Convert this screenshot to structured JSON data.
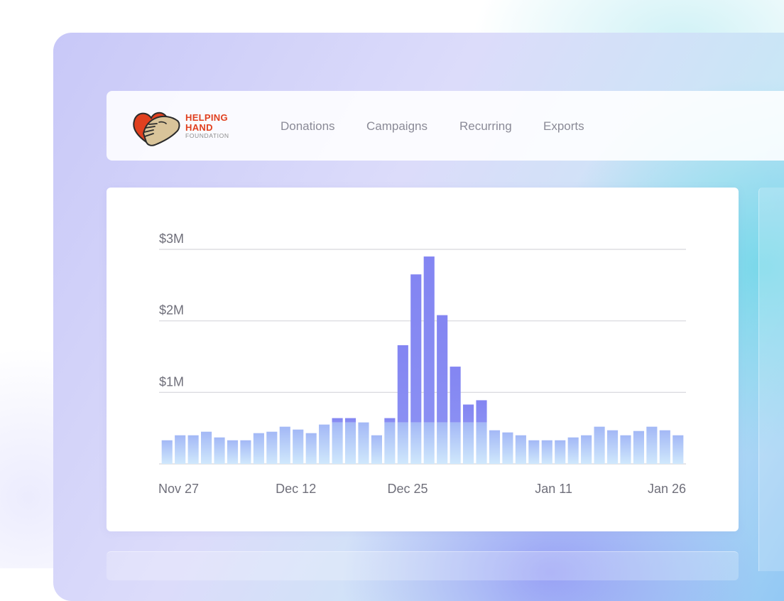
{
  "brand": {
    "line1": "HELPING",
    "line2": "HAND",
    "line3": "FOUNDATION",
    "colors": {
      "heart": "#e0401f",
      "hand": "#d9c49a",
      "outline": "#2b2b2b"
    }
  },
  "nav": {
    "items": [
      {
        "label": "Donations"
      },
      {
        "label": "Campaigns"
      },
      {
        "label": "Recurring"
      },
      {
        "label": "Exports"
      }
    ]
  },
  "chart_data": {
    "type": "bar",
    "title": "",
    "xlabel": "",
    "ylabel": "",
    "ylim": [
      0,
      3000000
    ],
    "y_ticks": [
      {
        "value": 1000000,
        "label": "$1M"
      },
      {
        "value": 2000000,
        "label": "$2M"
      },
      {
        "value": 3000000,
        "label": "$3M"
      }
    ],
    "x_tick_labels": [
      {
        "index": 0,
        "label": "Nov 27"
      },
      {
        "index": 15,
        "label": "Dec 12"
      },
      {
        "index": 28,
        "label": "Dec 25"
      },
      {
        "index": 45,
        "label": "Jan 11"
      },
      {
        "index": 60,
        "label": "Jan 26"
      }
    ],
    "grid": true,
    "legend": "none",
    "colors": {
      "bar_top": "#8385f2",
      "bar_bottom": "#c9e2fb",
      "bar_light": "#a4c7f7",
      "grid": "#d6d6dc"
    },
    "values": [
      330000,
      400000,
      400000,
      450000,
      370000,
      330000,
      330000,
      430000,
      450000,
      520000,
      480000,
      430000,
      550000,
      640000,
      640000,
      580000,
      400000,
      640000,
      1660000,
      2650000,
      2900000,
      2080000,
      1360000,
      830000,
      890000,
      470000,
      440000,
      400000,
      330000,
      330000,
      330000,
      370000,
      400000,
      520000,
      470000,
      400000,
      460000,
      520000,
      470000,
      400000
    ]
  }
}
